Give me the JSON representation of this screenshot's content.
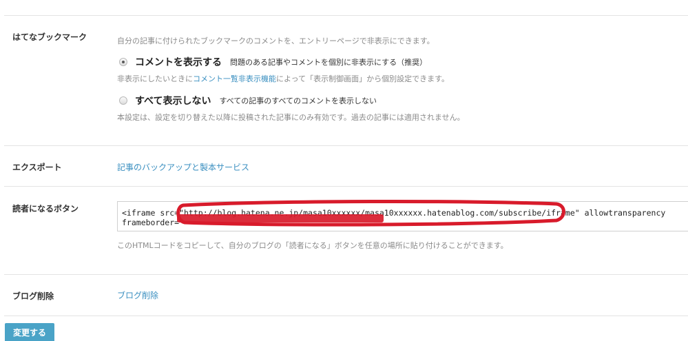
{
  "bookmark": {
    "label": "はてなブックマーク",
    "description": "自分の記事に付けられたブックマークのコメントを、エントリーページで非表示にできます。",
    "option_show": {
      "title": "コメントを表示する",
      "desc": "問題のある記事やコメントを個別に非表示にする（推奨）",
      "note_prefix": "非表示にしたいときに",
      "note_link": "コメント一覧非表示機能",
      "note_suffix": "によって「表示制御画面」から個別設定できます。",
      "selected": true
    },
    "option_hide": {
      "title": "すべて表示しない",
      "desc": "すべての記事のすべてのコメントを表示しない",
      "note": "本設定は、設定を切り替えた以降に投稿された記事にのみ有効です。過去の記事には適用されません。",
      "selected": false
    }
  },
  "export": {
    "label": "エクスポート",
    "link": "記事のバックアップと製本サービス"
  },
  "subscribe": {
    "label": "読者になるボタン",
    "code_line1": "<iframe src=\"http://blog.hatena.ne.jp/masa10xxxxxx/masa10xxxxxx.hatenablog.com/subscribe/iframe\" allowtransparency",
    "code_line2": "frameborder=\"",
    "help": "このHTMLコードをコピーして、自分のブログの「読者になる」ボタンを任意の場所に貼り付けることができます。"
  },
  "delete": {
    "label": "ブログ削除",
    "link": "ブログ削除"
  },
  "submit_label": "変更する",
  "colors": {
    "link": "#3a8fc0",
    "button": "#4aa3c7",
    "redaction": "#d81b2b"
  }
}
